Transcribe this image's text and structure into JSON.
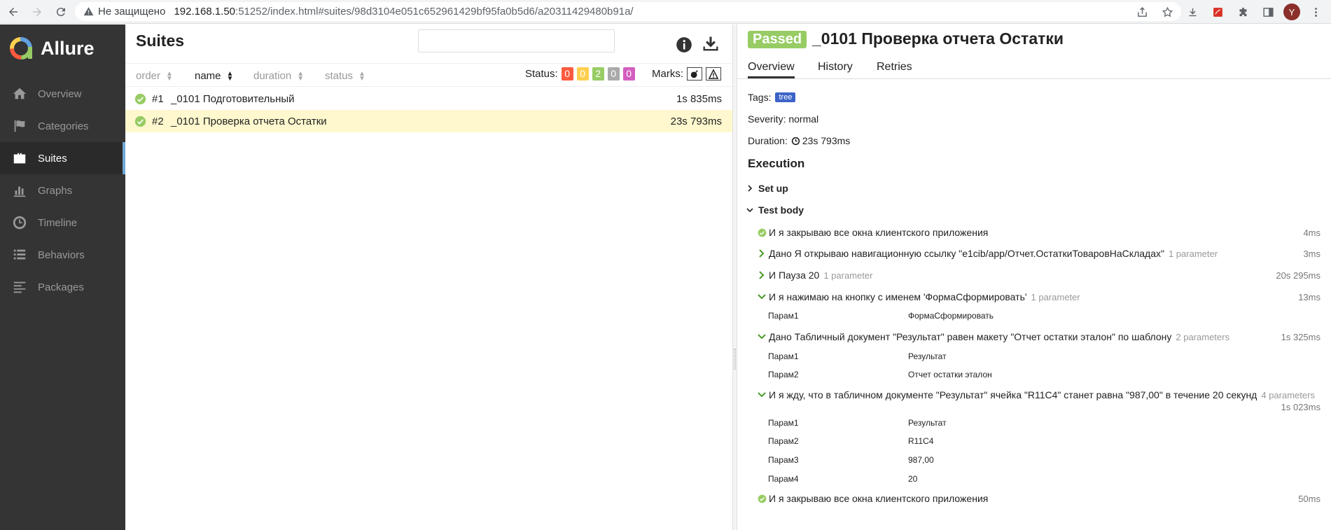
{
  "browser": {
    "security_label": "Не защищено",
    "url_host": "192.168.1.50",
    "url_path": ":51252/index.html#suites/98d3104e051c652961429bf95fa0b5d6/a20311429480b91a/",
    "profile_initial": "Y"
  },
  "sidebar": {
    "brand": "Allure",
    "items": [
      {
        "label": "Overview",
        "icon": "home-icon"
      },
      {
        "label": "Categories",
        "icon": "flag-icon"
      },
      {
        "label": "Suites",
        "icon": "briefcase-icon"
      },
      {
        "label": "Graphs",
        "icon": "bar-chart-icon"
      },
      {
        "label": "Timeline",
        "icon": "clock-icon"
      },
      {
        "label": "Behaviors",
        "icon": "list-icon"
      },
      {
        "label": "Packages",
        "icon": "align-left-icon"
      }
    ],
    "active": "Suites"
  },
  "suites": {
    "title": "Suites",
    "columns": {
      "order": "order",
      "name": "name",
      "duration": "duration",
      "status": "status"
    },
    "status_label": "Status:",
    "status_counts": [
      {
        "value": "0",
        "color": "#fd5a3e"
      },
      {
        "value": "0",
        "color": "#ffd050"
      },
      {
        "value": "2",
        "color": "#97cc64"
      },
      {
        "value": "0",
        "color": "#aaaaaa"
      },
      {
        "value": "0",
        "color": "#d35ebe"
      }
    ],
    "marks_label": "Marks:",
    "rows": [
      {
        "num": "#1",
        "name": "_0101 Подготовительный",
        "duration": "1s 835ms"
      },
      {
        "num": "#2",
        "name": "_0101 Проверка отчета Остатки",
        "duration": "23s 793ms"
      }
    ]
  },
  "result": {
    "status": "Passed",
    "title": "_0101 Проверка отчета Остатки",
    "tabs": [
      "Overview",
      "History",
      "Retries"
    ],
    "tags_label": "Tags:",
    "tag": "tree",
    "severity": "Severity: normal",
    "duration_label": "Duration:",
    "duration_value": "23s 793ms",
    "execution_title": "Execution",
    "setup_label": "Set up",
    "body_label": "Test body",
    "steps": [
      {
        "text": "И я закрываю все окна клиентского приложения",
        "count": "",
        "time": "4ms"
      },
      {
        "text": "Дано Я открываю навигационную ссылку \"e1cib/app/Отчет.ОстаткиТоваровНаСкладах\"",
        "count": "1 parameter",
        "time": "3ms"
      },
      {
        "text": "И Пауза 20",
        "count": "1 parameter",
        "time": "20s 295ms"
      },
      {
        "text": "И я нажимаю на кнопку с именем 'ФормаСформировать'",
        "count": "1 parameter",
        "time": "13ms"
      },
      {
        "text": "Дано Табличный документ \"Результат\" равен макету \"Отчет остатки эталон\" по шаблону",
        "count": "2 parameters",
        "time": "1s 325ms"
      },
      {
        "text": "И я жду, что в табличном документе \"Результат\" ячейка \"R11C4\" станет равна \"987,00\" в течение 20 секунд",
        "count": "4 parameters",
        "time": "1s 023ms"
      },
      {
        "text": "И я закрываю все окна клиентского приложения",
        "count": "",
        "time": "50ms"
      }
    ],
    "params": {
      "s4": [
        {
          "name": "Парам1",
          "value": "ФормаСформировать"
        }
      ],
      "s5": [
        {
          "name": "Парам1",
          "value": "Результат"
        },
        {
          "name": "Парам2",
          "value": "Отчет остатки эталон"
        }
      ],
      "s6": [
        {
          "name": "Парам1",
          "value": "Результат"
        },
        {
          "name": "Парам2",
          "value": "R11C4"
        },
        {
          "name": "Парам3",
          "value": "987,00"
        },
        {
          "name": "Парам4",
          "value": "20"
        }
      ]
    }
  },
  "colors": {
    "passed": "#97cc64",
    "sidebar_bg": "#343434",
    "active_row": "#fff8ce",
    "tag": "#3c64c8"
  }
}
